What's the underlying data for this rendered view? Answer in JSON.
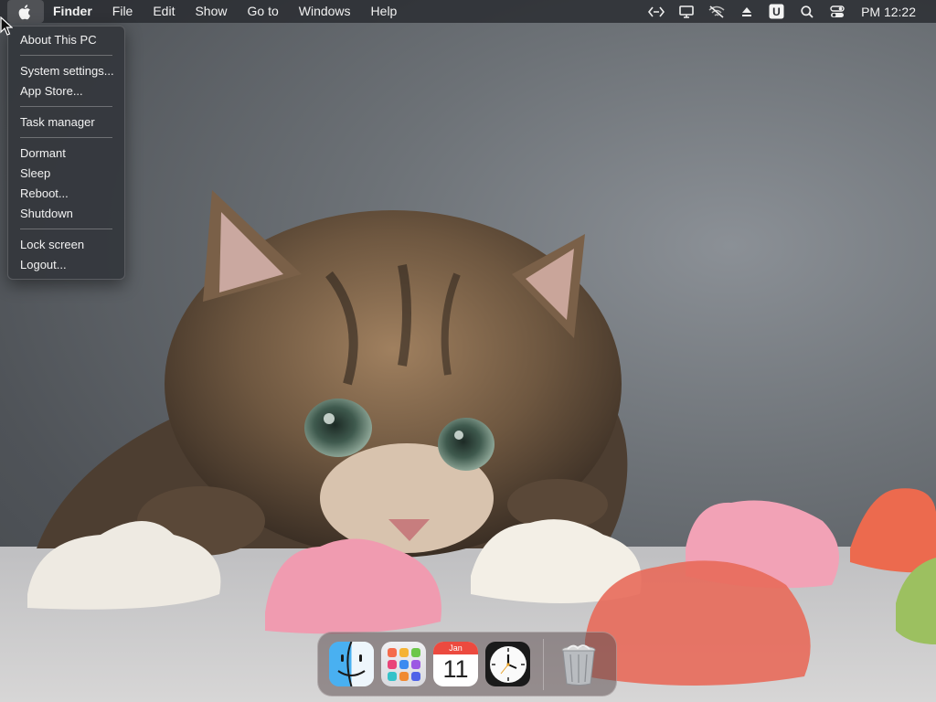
{
  "menubar": {
    "apple_icon": "apple-logo-icon",
    "app_name": "Finder",
    "menus": [
      "File",
      "Edit",
      "Show",
      "Go to",
      "Windows",
      "Help"
    ],
    "status_icons": [
      "code-brackets-icon",
      "display-icon",
      "wifi-off-icon",
      "eject-icon",
      "u-badge-icon",
      "search-icon",
      "control-center-icon"
    ],
    "u_badge": "U",
    "clock": "PM 12:22"
  },
  "apple_menu": {
    "about": "About This PC",
    "system_settings": "System settings...",
    "app_store": "App Store...",
    "task_manager": "Task manager",
    "dormant": "Dormant",
    "sleep": "Sleep",
    "reboot": "Reboot...",
    "shutdown": "Shutdown",
    "lock_screen": "Lock screen",
    "logout": "Logout..."
  },
  "dock": {
    "apps": [
      {
        "name": "Finder",
        "icon": "finder-icon",
        "running": true
      },
      {
        "name": "Launchpad",
        "icon": "launchpad-icon",
        "running": false
      },
      {
        "name": "Calendar",
        "icon": "calendar-icon",
        "running": false
      },
      {
        "name": "Clock",
        "icon": "clock-icon",
        "running": false
      },
      {
        "name": "Trash",
        "icon": "trash-icon",
        "running": false
      }
    ],
    "calendar_month": "Jan",
    "calendar_day": "11"
  },
  "wallpaper": {
    "subject": "kitten-peeking-over-table-wallpaper"
  },
  "colors": {
    "menubar_bg": "#282b2f",
    "dropdown_bg": "#34373c",
    "calendar_red": "#ec4a3f"
  }
}
